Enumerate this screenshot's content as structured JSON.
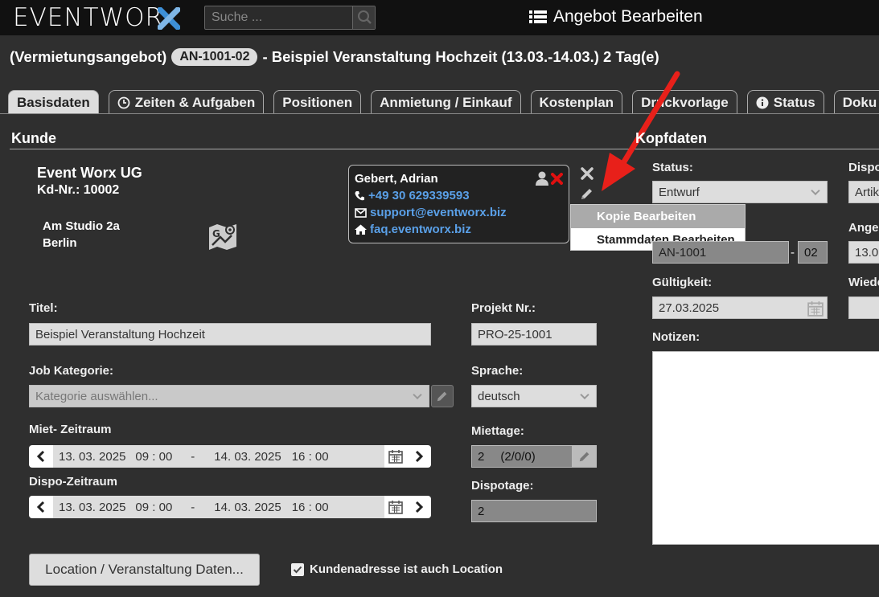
{
  "app": {
    "logo_text": "EVENTWOR",
    "search_placeholder": "Suche ...",
    "page_heading": "Angebot Bearbeiten"
  },
  "header": {
    "prefix": "(Vermietungsangebot)",
    "number": "AN-1001-02",
    "title": "- Beispiel Veranstaltung Hochzeit (13.03.-14.03.) 2 Tag(e)"
  },
  "tabs": [
    {
      "label": "Basisdaten",
      "active": true
    },
    {
      "label": "Zeiten & Aufgaben",
      "icon": "clock-icon"
    },
    {
      "label": "Positionen"
    },
    {
      "label": "Anmietung / Einkauf"
    },
    {
      "label": "Kostenplan"
    },
    {
      "label": "Druckvorlage"
    },
    {
      "label": "Status",
      "icon": "info-icon"
    },
    {
      "label": "Doku"
    }
  ],
  "customer": {
    "section_title": "Kunde",
    "name": "Event Worx UG",
    "number": "Kd-Nr.: 10002",
    "street": "Am Studio 2a",
    "city": "Berlin"
  },
  "contact": {
    "name": "Gebert, Adrian",
    "phone": "+49 30 629339593",
    "email": "support@eventworx.biz",
    "web": "faq.eventworx.biz"
  },
  "edit_menu": {
    "items": [
      "Kopie Bearbeiten",
      "Stammdaten Bearbeiten"
    ]
  },
  "form": {
    "titel_label": "Titel:",
    "titel_value": "Beispiel Veranstaltung Hochzeit",
    "projekt_label": "Projekt Nr.:",
    "projekt_value": "PRO-25-1001",
    "kategorie_label": "Job Kategorie:",
    "kategorie_placeholder": "Kategorie auswählen...",
    "sprache_label": "Sprache:",
    "sprache_value": "deutsch",
    "miet_label": "Miet- Zeitraum",
    "miet_start_date": "13. 03. 2025",
    "miet_start_time": "09 : 00",
    "miet_sep": "-",
    "miet_end_date": "14. 03. 2025",
    "miet_end_time": "16 : 00",
    "miettage_label": "Miettage:",
    "miettage_value": "2",
    "miettage_detail": "(2/0/0)",
    "dispo_label": "Dispo-Zeitraum",
    "dispo_start_date": "13. 03. 2025",
    "dispo_start_time": "09 : 00",
    "dispo_sep": "-",
    "dispo_end_date": "14. 03. 2025",
    "dispo_end_time": "16 : 00",
    "dispotage_label": "Dispotage:",
    "dispotage_value": "2",
    "location_button": "Location / Veranstaltung Daten...",
    "location_checkbox_label": "Kundenadresse ist auch Location",
    "location_checkbox_checked": true
  },
  "kopfdaten": {
    "section_title": "Kopfdaten",
    "status_label": "Status:",
    "status_value": "Entwurf",
    "dispo_label": "Dispo",
    "dispo_value": "Artik",
    "number_value": "AN-1001",
    "number_suffix_sep": "-",
    "number_suffix": "02",
    "angebot_label": "Angel",
    "angebot_value": "13.0",
    "gueltigkeit_label": "Gültigkeit:",
    "gueltigkeit_value": "27.03.2025",
    "wieder_label": "Wiede",
    "notizen_label": "Notizen:"
  },
  "colors": {
    "accent_blue": "#5aa0e8",
    "arrow_red": "#e8201a",
    "logo_x_blue": "#3d8fd6"
  }
}
